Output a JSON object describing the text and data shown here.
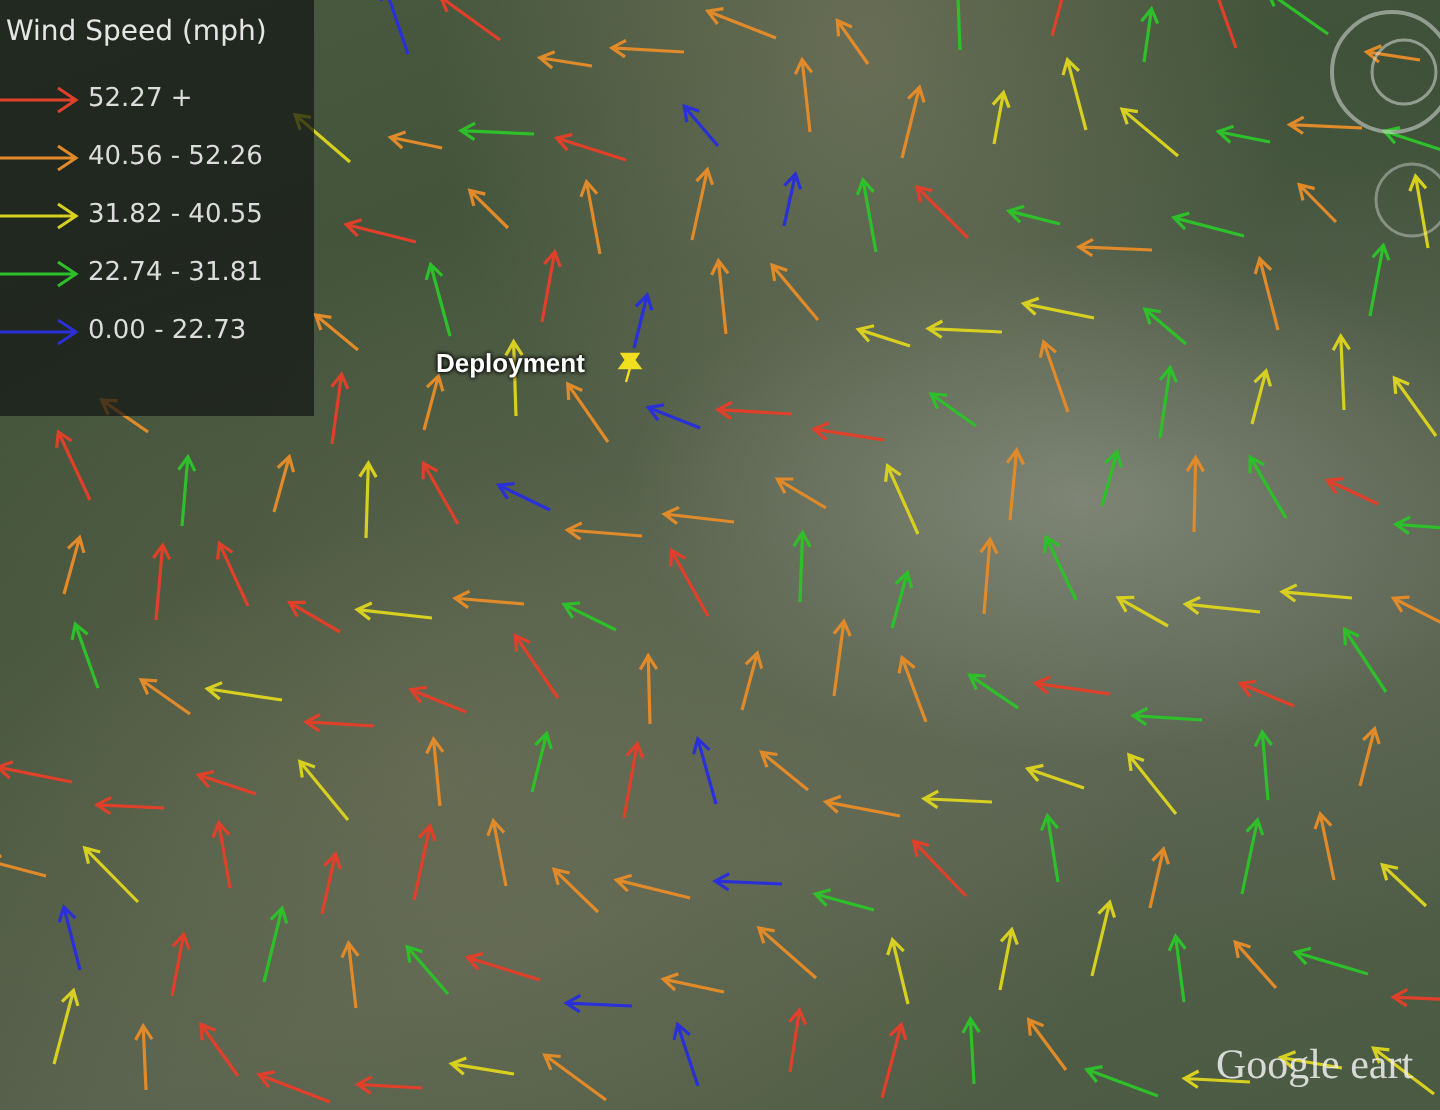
{
  "legend": {
    "title": "Wind Speed (mph)",
    "items": [
      {
        "label": "52.27 +",
        "color": "#e0402a"
      },
      {
        "label": "40.56 - 52.26",
        "color": "#e08a2a"
      },
      {
        "label": "31.82 - 40.55",
        "color": "#d8d020"
      },
      {
        "label": "22.74 - 31.81",
        "color": "#2ec02a"
      },
      {
        "label": "0.00 - 22.73",
        "color": "#2a30d8"
      }
    ]
  },
  "placemark": {
    "label": "Deployment"
  },
  "logo": {
    "text": "Google eart"
  }
}
